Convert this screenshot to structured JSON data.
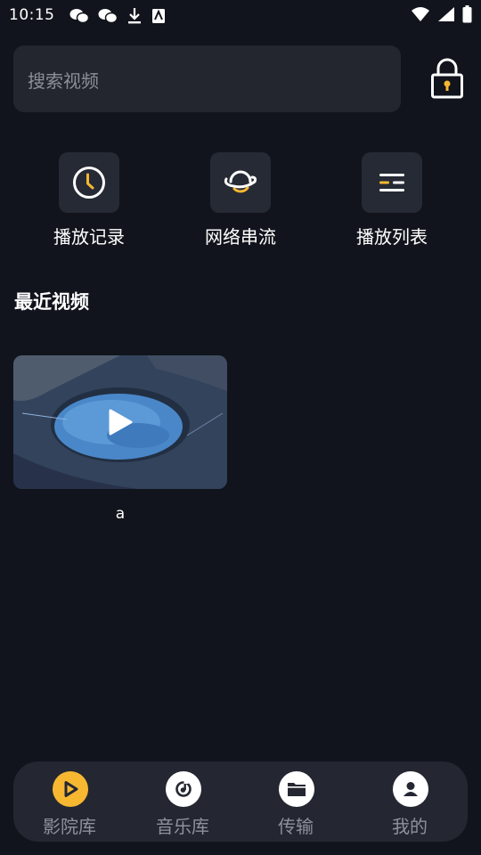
{
  "status_bar": {
    "time": "10:15",
    "left_icons": [
      "wechat-icon",
      "wechat-icon",
      "download-icon",
      "app-notification-icon"
    ],
    "right_icons": [
      "wifi-icon",
      "signal-icon",
      "battery-icon"
    ]
  },
  "search": {
    "placeholder": "搜索视频"
  },
  "lock": {
    "icon": "lock-icon"
  },
  "quick_actions": [
    {
      "label": "播放记录",
      "icon": "clock-icon"
    },
    {
      "label": "网络串流",
      "icon": "planet-icon"
    },
    {
      "label": "播放列表",
      "icon": "list-icon"
    }
  ],
  "recent": {
    "title": "最近视频",
    "videos": [
      {
        "title": "a",
        "icon": "play-icon"
      }
    ]
  },
  "bottom_nav": {
    "items": [
      {
        "label": "影院库",
        "icon": "play-circle-icon",
        "active": true
      },
      {
        "label": "音乐库",
        "icon": "music-icon",
        "active": false
      },
      {
        "label": "传输",
        "icon": "folder-icon",
        "active": false
      },
      {
        "label": "我的",
        "icon": "user-icon",
        "active": false
      }
    ]
  },
  "colors": {
    "background": "#11141c",
    "surface": "#23252f",
    "accent": "#f7b731",
    "muted_text": "#8e919b"
  }
}
